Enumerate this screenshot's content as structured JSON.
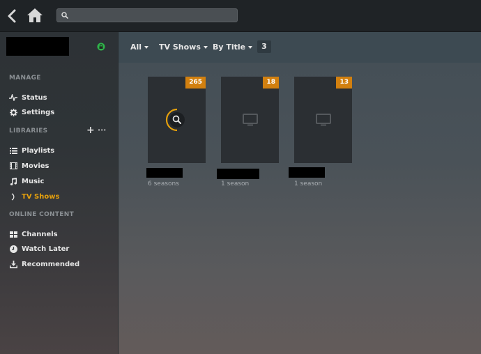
{
  "search": {
    "value": "",
    "placeholder": ""
  },
  "sidebar": {
    "manage_title": "MANAGE",
    "manage_items": [
      {
        "label": "Status",
        "icon": "pulse-icon"
      },
      {
        "label": "Settings",
        "icon": "gear-icon"
      }
    ],
    "libraries_title": "LIBRARIES",
    "library_items": [
      {
        "label": "Playlists",
        "icon": "list-icon"
      },
      {
        "label": "Movies",
        "icon": "film-icon"
      },
      {
        "label": "Music",
        "icon": "music-note-icon"
      },
      {
        "label": "TV Shows",
        "icon": "spinner-icon",
        "active": true
      }
    ],
    "online_title": "ONLINE CONTENT",
    "online_items": [
      {
        "label": "Channels",
        "icon": "grid-icon"
      },
      {
        "label": "Watch Later",
        "icon": "clock-icon"
      },
      {
        "label": "Recommended",
        "icon": "download-icon"
      }
    ],
    "add_symbol": "+",
    "more_symbol": "•••"
  },
  "filterbar": {
    "all_label": "All",
    "type_label": "TV Shows",
    "sort_label": "By Title",
    "count": "3"
  },
  "items": [
    {
      "badge": "265",
      "subtitle": "6 seasons"
    },
    {
      "badge": "18",
      "subtitle": "1 season"
    },
    {
      "badge": "13",
      "subtitle": "1 season"
    }
  ],
  "colors": {
    "accent": "#e5a00d",
    "badge": "#d2800f",
    "topbar": "#1f2326",
    "sidebar": "#2d3236"
  }
}
